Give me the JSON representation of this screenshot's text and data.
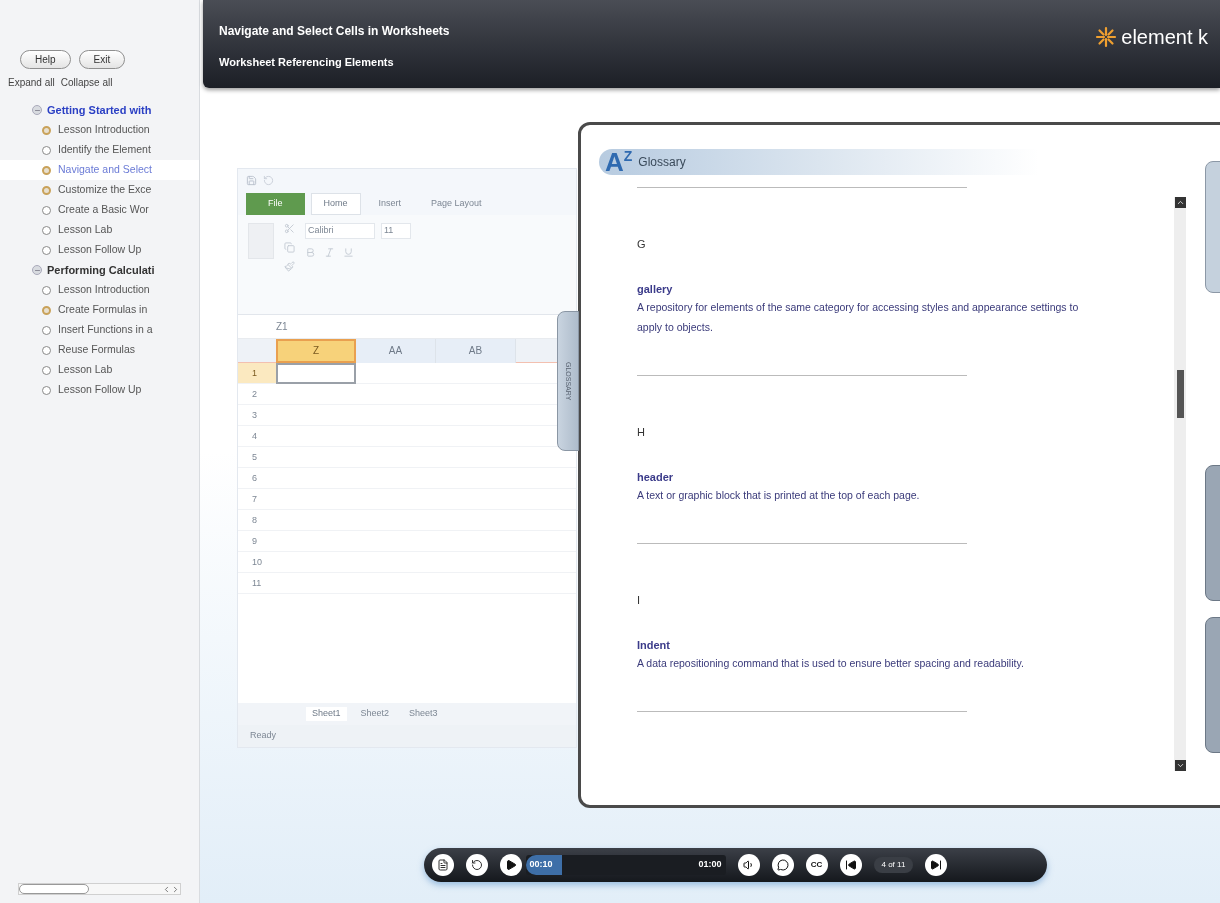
{
  "sidebar": {
    "buttons": [
      "Help",
      "Exit"
    ],
    "links": [
      "Expand all",
      "Collapse all"
    ],
    "tree": [
      {
        "title": "Getting Started with",
        "expanded": true,
        "active": true,
        "children": [
          {
            "label": "Lesson Introduction",
            "visited": true,
            "selected": false
          },
          {
            "label": "Identify the Element",
            "visited": false,
            "selected": false
          },
          {
            "label": "Navigate and Select",
            "visited": true,
            "selected": true
          },
          {
            "label": "Customize the Exce",
            "visited": true,
            "selected": false
          },
          {
            "label": "Create a Basic Wor",
            "visited": false,
            "selected": false
          },
          {
            "label": "Lesson Lab",
            "visited": false,
            "selected": false
          },
          {
            "label": "Lesson Follow Up",
            "visited": false,
            "selected": false
          }
        ]
      },
      {
        "title": "Performing Calculati",
        "expanded": true,
        "active": false,
        "children": [
          {
            "label": "Lesson Introduction",
            "visited": false,
            "selected": false
          },
          {
            "label": "Create Formulas in",
            "visited": true,
            "selected": false
          },
          {
            "label": "Insert Functions in a",
            "visited": false,
            "selected": false
          },
          {
            "label": "Reuse Formulas",
            "visited": false,
            "selected": false
          },
          {
            "label": "Lesson Lab",
            "visited": false,
            "selected": false
          },
          {
            "label": "Lesson Follow Up",
            "visited": false,
            "selected": false
          }
        ]
      }
    ]
  },
  "header": {
    "title": "Navigate and Select Cells in Worksheets",
    "subtitle": "Worksheet Referencing Elements",
    "logo": "element k"
  },
  "worksheet": {
    "ribbon_tabs": [
      {
        "label": "File",
        "selected": false,
        "kind": "file"
      },
      {
        "label": "Home",
        "selected": true,
        "kind": "tab"
      },
      {
        "label": "Insert",
        "selected": false,
        "kind": "tab"
      },
      {
        "label": "Page Layout",
        "selected": false,
        "kind": "tab"
      }
    ],
    "font": "Calibri",
    "font_size": "11",
    "name_box": "Z1",
    "columns": [
      {
        "label": "Z",
        "selected": true
      },
      {
        "label": "AA",
        "selected": false
      },
      {
        "label": "AB",
        "selected": false
      }
    ],
    "rows": [
      "1",
      "2",
      "3",
      "4",
      "5",
      "6",
      "7",
      "8",
      "9",
      "10",
      "11"
    ],
    "sheets": [
      {
        "label": "Sheet1",
        "selected": true
      },
      {
        "label": "Sheet2",
        "selected": false
      },
      {
        "label": "Sheet3",
        "selected": false
      }
    ],
    "status": "Ready"
  },
  "glossary": {
    "tab_label": "GLOSSARY",
    "icon_letters": [
      "A",
      "Z"
    ],
    "title": "Glossary",
    "sections": [
      {
        "letter": "G",
        "terms": [
          {
            "term": "gallery",
            "definition": "A repository for elements of the same category for accessing styles and appearance settings to apply to objects."
          }
        ]
      },
      {
        "letter": "H",
        "terms": [
          {
            "term": "header",
            "definition": "A text or graphic block that is printed at the top of each page."
          }
        ]
      },
      {
        "letter": "I",
        "terms": [
          {
            "term": "Indent",
            "definition": "A data repositioning command that is used to ensure better spacing and readability."
          }
        ]
      }
    ]
  },
  "side_tabs": [
    {
      "selected": true
    },
    {
      "selected": false
    },
    {
      "selected": false
    }
  ],
  "player": {
    "elapsed": "00:10",
    "total": "01:00",
    "level": 0.18,
    "cc_label": "CC",
    "page": "4 of 11"
  }
}
